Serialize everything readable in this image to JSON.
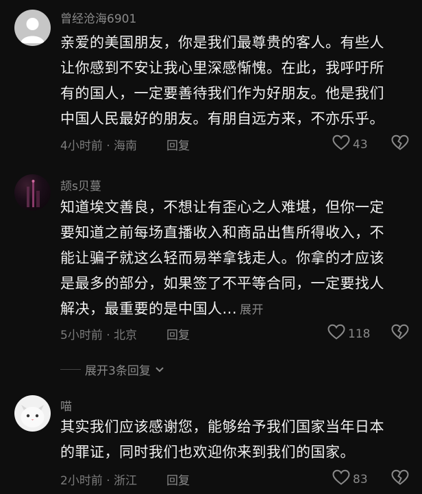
{
  "comments": [
    {
      "username": "曾经沧海6901",
      "lines": [
        "亲爱的美国朋友，你是我们最尊贵的客人。有些人",
        "让你感到不安让我心里深感惭愧。在此，我呼吁所",
        "有的国人，一定要善待我们作为好朋友。他是我们",
        "中国人民最好的朋友。有朋自远方来，不亦乐乎。"
      ],
      "meta": "4小时前 · 海南",
      "reply_label": "回复",
      "likes": "43"
    },
    {
      "username": "颉s贝蔓",
      "lines": [
        "知道埃文善良，不想让有歪心之人难堪，但你一定",
        "要知道之前每场直播收入和商品出售所得收入，不",
        "能让骗子就这么轻而易举拿钱走人。你拿的才应该",
        "是最多的部分，如果签了不平等合同，一定要找人",
        "解决，最重要的是中国人..."
      ],
      "expand_inline": "展开",
      "meta": "5小时前 · 北京",
      "reply_label": "回复",
      "likes": "118",
      "expand_replies": "展开3条回复"
    },
    {
      "username": "喵",
      "lines": [
        "其实我们应该感谢您，能够给予我们国家当年日本",
        "的罪证，同时我们也欢迎你来到我们的国家。"
      ],
      "meta": "2小时前 · 浙江",
      "reply_label": "回复",
      "likes": "83"
    }
  ],
  "icons": {
    "like": "heart-outline-icon",
    "dislike": "broken-heart-icon",
    "expand": "chevron-down-icon"
  }
}
